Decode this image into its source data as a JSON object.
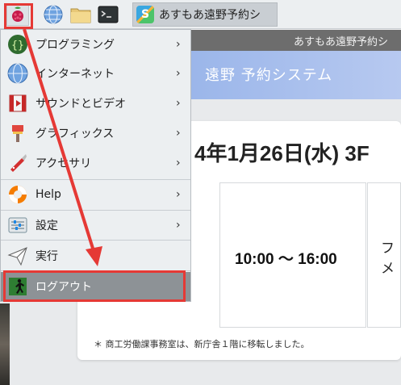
{
  "taskbar": {
    "task_title": "あすもあ遠野予約シ"
  },
  "browser": {
    "tab_title": "あすもあ遠野予約シ",
    "header_title": "遠野 予約システム",
    "date_heading": "4年1月26日(水) 3F",
    "time_slot": "10:00 〜 16:00",
    "right_cell_lines": [
      "フ",
      "メ"
    ],
    "footnote": "＊ 商工労働課事務室は、新庁舎１階に移転しました。"
  },
  "menu": {
    "items": [
      {
        "label": "プログラミング",
        "icon": "braces-icon",
        "submenu": true
      },
      {
        "label": "インターネット",
        "icon": "globe-icon",
        "submenu": true
      },
      {
        "label": "サウンドとビデオ",
        "icon": "film-icon",
        "submenu": true
      },
      {
        "label": "グラフィックス",
        "icon": "brush-icon",
        "submenu": true
      },
      {
        "label": "アクセサリ",
        "icon": "knife-icon",
        "submenu": true
      },
      {
        "label": "Help",
        "icon": "lifebuoy-icon",
        "submenu": true
      },
      {
        "label": "設定",
        "icon": "settings-icon",
        "submenu": true
      },
      {
        "label": "実行",
        "icon": "paper-plane-icon",
        "submenu": false
      },
      {
        "label": "ログアウト",
        "icon": "exit-icon",
        "submenu": false
      }
    ],
    "chevron": "›"
  },
  "colors": {
    "annotation_red": "#e53935",
    "menu_bg": "#eceff1",
    "logout_bg": "#8d9296"
  }
}
